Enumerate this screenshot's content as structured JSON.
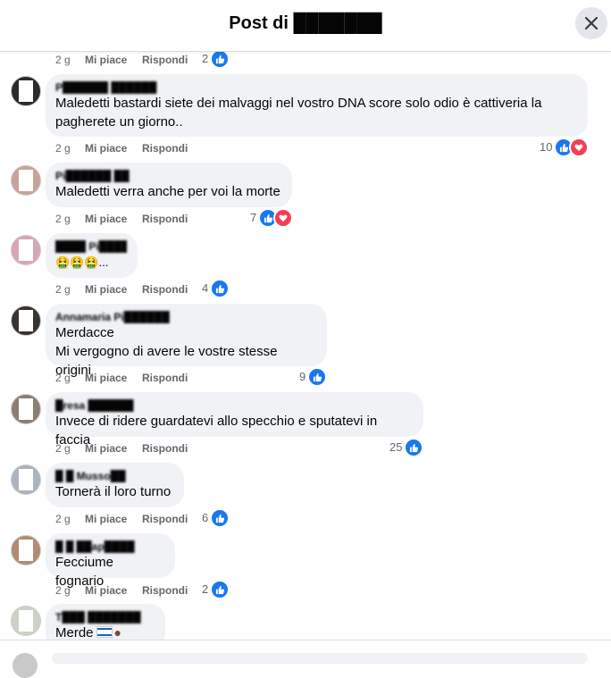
{
  "header": {
    "title": "Post di ███████"
  },
  "top_actions": {
    "time": "2 g",
    "like": "Mi piace",
    "reply": "Rispondi",
    "count": "2"
  },
  "comments": [
    {
      "author": "P██████ ██████",
      "lines": [
        "Maledetti bastardi siete dei malvaggi nel vostro DNA score solo odio è cattiveria la",
        "pagherete un giorno.."
      ],
      "time": "2 g",
      "like": "Mi piace",
      "reply": "Rispondi",
      "count": "10",
      "love": true
    },
    {
      "author": "Pi██████ ██",
      "lines": [
        "Maledetti verra anche per voi la morte"
      ],
      "time": "2 g",
      "like": "Mi piace",
      "reply": "Rispondi",
      "count": "7",
      "love": true
    },
    {
      "author": "████ Pi████",
      "lines": [
        "🤮🤮🤮..."
      ],
      "time": "2 g",
      "like": "Mi piace",
      "reply": "Rispondi",
      "count": "4",
      "love": false
    },
    {
      "author": "Annamaria Pi██████",
      "lines": [
        "Merdacce",
        "Mi vergogno di avere le vostre stesse origini"
      ],
      "time": "2 g",
      "like": "Mi piace",
      "reply": "Rispondi",
      "count": "9",
      "love": false
    },
    {
      "author": "█resa ██████",
      "lines": [
        "Invece di ridere guardatevi allo specchio e sputatevi in faccia"
      ],
      "time": "2 g",
      "like": "Mi piace",
      "reply": "Rispondi",
      "count": "25",
      "love": false
    },
    {
      "author": "█ █ Musso██",
      "lines": [
        "Tornerà il loro turno"
      ],
      "time": "2 g",
      "like": "Mi piace",
      "reply": "Rispondi",
      "count": "6",
      "love": false
    },
    {
      "author": "█ █ ██ap████",
      "lines": [
        "Fecciume fognario"
      ],
      "time": "2 g",
      "like": "Mi piace",
      "reply": "Rispondi",
      "count": "2",
      "love": false
    },
    {
      "author": "T███ ███████",
      "lines": [
        "Merde"
      ],
      "time": "",
      "like": "",
      "reply": "",
      "count": "",
      "love": false
    }
  ],
  "colors": {
    "like": "#1877f2",
    "love": "#f33e58",
    "bubble": "#f0f2f5",
    "meta": "#65676b"
  },
  "icons": {
    "close": "close-icon",
    "like": "thumbs-up-icon",
    "love": "heart-icon"
  }
}
